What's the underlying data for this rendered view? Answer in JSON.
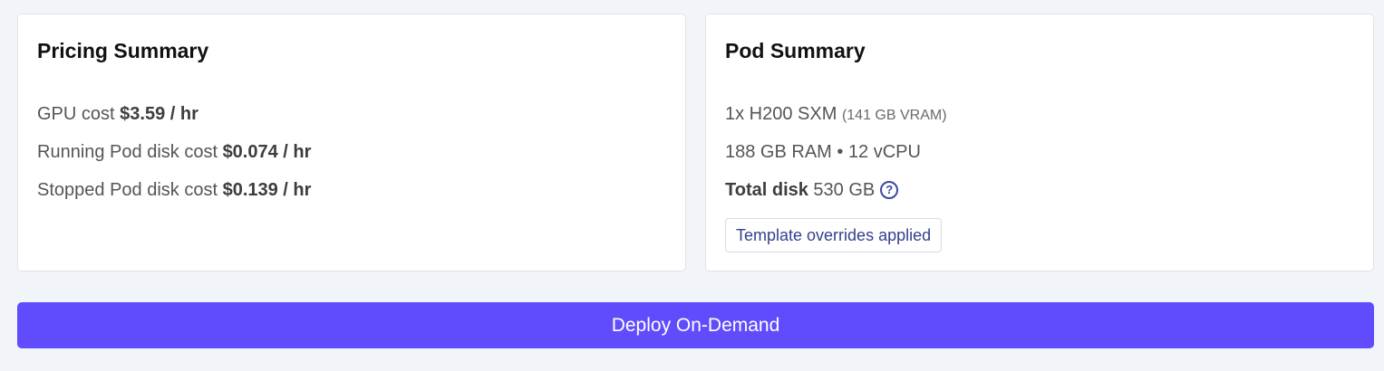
{
  "pricing": {
    "title": "Pricing Summary",
    "gpu_label": "GPU cost ",
    "gpu_value": "$3.59 / hr",
    "running_label": "Running Pod disk cost ",
    "running_value": "$0.074 / hr",
    "stopped_label": "Stopped Pod disk cost ",
    "stopped_value": "$0.139 / hr"
  },
  "pod": {
    "title": "Pod Summary",
    "gpu": "1x H200 SXM ",
    "vram": "(141 GB VRAM)",
    "specs": "188 GB RAM • 12 vCPU",
    "disk_label": "Total disk ",
    "disk_value": "530 GB",
    "help_icon": "question-circle",
    "badge": "Template overrides applied"
  },
  "deploy": {
    "label": "Deploy On-Demand"
  },
  "colors": {
    "accent": "#604cfd",
    "badge_text": "#34408f",
    "background": "#f1f4f9"
  }
}
